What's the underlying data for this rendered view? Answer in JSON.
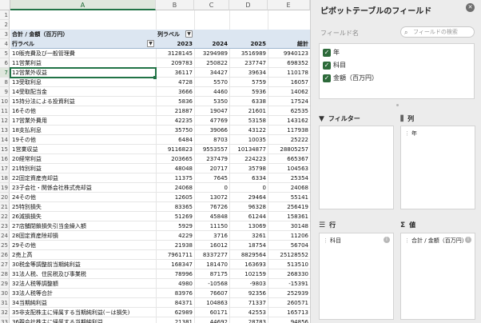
{
  "columns": [
    "A",
    "B",
    "C",
    "D",
    "E"
  ],
  "header_row3": {
    "a": "合計 / 金額（百万円）",
    "b": "列ラベル"
  },
  "header_row4": {
    "a": "行ラベル",
    "b": "2023",
    "c": "2024",
    "d": "2025",
    "e": "総計"
  },
  "rows": [
    {
      "n": "5",
      "label": "10販売費及び一般管理費",
      "v": [
        "3128145",
        "3294989",
        "3516989",
        "9940123"
      ]
    },
    {
      "n": "6",
      "label": "11営業利益",
      "v": [
        "209783",
        "250822",
        "237747",
        "698352"
      ]
    },
    {
      "n": "7",
      "label": "12営業外収益",
      "v": [
        "36117",
        "34427",
        "39634",
        "110178"
      ]
    },
    {
      "n": "8",
      "label": "13受取利息",
      "v": [
        "4728",
        "5570",
        "5759",
        "16057"
      ]
    },
    {
      "n": "9",
      "label": "14受取配当金",
      "v": [
        "3666",
        "4460",
        "5936",
        "14062"
      ]
    },
    {
      "n": "10",
      "label": "15持分法による投資利益",
      "v": [
        "5836",
        "5350",
        "6338",
        "17524"
      ]
    },
    {
      "n": "11",
      "label": "16その他",
      "v": [
        "21887",
        "19047",
        "21601",
        "62535"
      ]
    },
    {
      "n": "12",
      "label": "17営業外費用",
      "v": [
        "42235",
        "47769",
        "53158",
        "143162"
      ]
    },
    {
      "n": "13",
      "label": "18支払利息",
      "v": [
        "35750",
        "39066",
        "43122",
        "117938"
      ]
    },
    {
      "n": "14",
      "label": "19その他",
      "v": [
        "6484",
        "8703",
        "10035",
        "25222"
      ]
    },
    {
      "n": "15",
      "label": "1営業収益",
      "v": [
        "9116823",
        "9553557",
        "10134877",
        "28805257"
      ]
    },
    {
      "n": "16",
      "label": "20経常利益",
      "v": [
        "203665",
        "237479",
        "224223",
        "665367"
      ]
    },
    {
      "n": "17",
      "label": "21特別利益",
      "v": [
        "48048",
        "20717",
        "35798",
        "104563"
      ]
    },
    {
      "n": "18",
      "label": "22固定資産売却益",
      "v": [
        "11375",
        "7645",
        "6334",
        "25354"
      ]
    },
    {
      "n": "19",
      "label": "23子会社・関係会社株式売却益",
      "v": [
        "24068",
        "0",
        "0",
        "24068"
      ]
    },
    {
      "n": "20",
      "label": "24その他",
      "v": [
        "12605",
        "13072",
        "29464",
        "55141"
      ]
    },
    {
      "n": "21",
      "label": "25特別損失",
      "v": [
        "83365",
        "76726",
        "96328",
        "256419"
      ]
    },
    {
      "n": "22",
      "label": "26減損損失",
      "v": [
        "51269",
        "45848",
        "61244",
        "158361"
      ]
    },
    {
      "n": "23",
      "label": "27店舗閉鎖損失引当金繰入額",
      "v": [
        "5929",
        "11150",
        "13069",
        "30148"
      ]
    },
    {
      "n": "24",
      "label": "28固定資産除却損",
      "v": [
        "4229",
        "3716",
        "3261",
        "11206"
      ]
    },
    {
      "n": "25",
      "label": "29その他",
      "v": [
        "21938",
        "16012",
        "18754",
        "56704"
      ]
    },
    {
      "n": "26",
      "label": "2売上高",
      "v": [
        "7961711",
        "8337277",
        "8829564",
        "25128552"
      ]
    },
    {
      "n": "27",
      "label": "30税金等調整前当期純利益",
      "v": [
        "168347",
        "181470",
        "163693",
        "513510"
      ]
    },
    {
      "n": "28",
      "label": "31法人税、住民税及び事業税",
      "v": [
        "78996",
        "87175",
        "102159",
        "268330"
      ]
    },
    {
      "n": "29",
      "label": "32法人税等調整額",
      "v": [
        "4980",
        "-10568",
        "-9803",
        "-15391"
      ]
    },
    {
      "n": "30",
      "label": "33法人税等合計",
      "v": [
        "83976",
        "76607",
        "92356",
        "252939"
      ]
    },
    {
      "n": "31",
      "label": "34当期純利益",
      "v": [
        "84371",
        "104863",
        "71337",
        "260571"
      ]
    },
    {
      "n": "32",
      "label": "35非支配株主に帰属する当期純利益(－は損失)",
      "v": [
        "62989",
        "60171",
        "42553",
        "165713"
      ]
    },
    {
      "n": "33",
      "label": "36親会社株主に帰属する当期純利益",
      "v": [
        "21381",
        "44692",
        "28783",
        "94856"
      ]
    }
  ],
  "pane": {
    "title": "ピボットテーブルのフィールド",
    "close_glyph": "✕",
    "fields_label": "フィールド名",
    "search_placeholder": "フィールドの検索",
    "fields": [
      {
        "label": "年"
      },
      {
        "label": "科目"
      },
      {
        "label": "金額（百万円）"
      }
    ],
    "areas": {
      "filters": {
        "title": "フィルター"
      },
      "columns": {
        "title": "列",
        "item": "年"
      },
      "rows": {
        "title": "行",
        "item": "科目"
      },
      "values": {
        "title": "値",
        "item": "合計 / 金額（百万円）"
      }
    }
  }
}
